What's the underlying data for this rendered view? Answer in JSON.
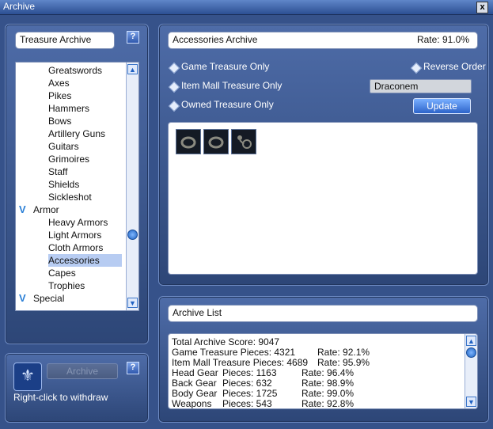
{
  "window": {
    "title": "Archive",
    "close_label": "x"
  },
  "left": {
    "category_field": "Treasure Archive",
    "help": "?",
    "tree": [
      {
        "label": "Greatswords",
        "level": 1
      },
      {
        "label": "Axes",
        "level": 1
      },
      {
        "label": "Pikes",
        "level": 1
      },
      {
        "label": "Hammers",
        "level": 1
      },
      {
        "label": "Bows",
        "level": 1
      },
      {
        "label": "Artillery Guns",
        "level": 1
      },
      {
        "label": "Guitars",
        "level": 1
      },
      {
        "label": "Grimoires",
        "level": 1
      },
      {
        "label": "Staff",
        "level": 1
      },
      {
        "label": "Shields",
        "level": 1
      },
      {
        "label": "Sickleshot",
        "level": 1
      },
      {
        "label": "Armor",
        "level": 0
      },
      {
        "label": "Heavy Armors",
        "level": 1
      },
      {
        "label": "Light Armors",
        "level": 1
      },
      {
        "label": "Cloth Armors",
        "level": 1
      },
      {
        "label": "Accessories",
        "level": 1,
        "selected": true
      },
      {
        "label": "Capes",
        "level": 1
      },
      {
        "label": "Trophies",
        "level": 1
      },
      {
        "label": "Special",
        "level": 0
      }
    ]
  },
  "withdraw": {
    "archive_button": "Archive",
    "help": "?",
    "hint": "Right-click to withdraw"
  },
  "accessories": {
    "title": "Accessories Archive",
    "rate": "Rate: 91.0%",
    "options": {
      "game_only": "Game Treasure Only",
      "reverse": "Reverse Order",
      "mall_only": "Item Mall Treasure Only",
      "owned_only": "Owned Treasure Only"
    },
    "search_value": "Draconem",
    "update_button": "Update",
    "slots": [
      "ring-item",
      "ring-item",
      "earring-item"
    ]
  },
  "archive_list": {
    "title": "Archive List",
    "lines": [
      {
        "a": "Total Archive Score: 9047",
        "b": "",
        "c": ""
      },
      {
        "a": "Game Treasure Pieces: 4321",
        "b": "",
        "c": "Rate: 92.1%"
      },
      {
        "a": "Item Mall Treasure Pieces: 4689",
        "b": "",
        "c": "Rate: 95.9%"
      },
      {
        "a": "Head Gear",
        "b": "Pieces: 1163",
        "c": "Rate: 96.4%"
      },
      {
        "a": "Back Gear",
        "b": "Pieces: 632",
        "c": "Rate: 98.9%"
      },
      {
        "a": "Body Gear",
        "b": "Pieces: 1725",
        "c": "Rate: 99.0%"
      },
      {
        "a": "Weapons",
        "b": "Pieces: 543",
        "c": "Rate: 92.8%"
      }
    ]
  },
  "colors": {
    "panel": "#2d4677",
    "accent": "#2a7fd6",
    "selection": "#b7ccf2"
  }
}
